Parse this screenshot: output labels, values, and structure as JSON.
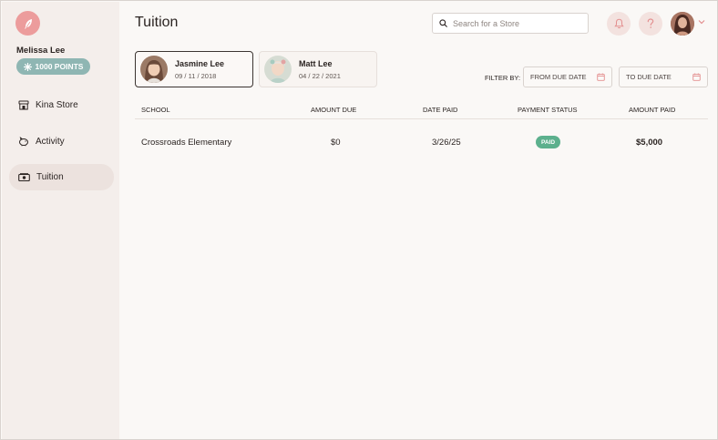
{
  "user": {
    "name": "Melissa Lee",
    "points_label": "1000 POINTS"
  },
  "sidebar": {
    "items": [
      {
        "label": "Kina Store",
        "icon": "store-icon"
      },
      {
        "label": "Activity",
        "icon": "piggy-bank-icon"
      },
      {
        "label": "Tuition",
        "icon": "money-icon",
        "active": true
      }
    ]
  },
  "header": {
    "title": "Tuition",
    "search_placeholder": "Search for a Store"
  },
  "students": [
    {
      "name": "Jasmine Lee",
      "dob": "09 / 11 / 2018",
      "selected": true
    },
    {
      "name": "Matt Lee",
      "dob": "04 / 22 / 2021",
      "selected": false
    }
  ],
  "filters": {
    "label": "FILTER BY:",
    "from_placeholder": "FROM DUE DATE",
    "to_placeholder": "TO DUE DATE"
  },
  "table": {
    "headers": [
      "SCHOOL",
      "AMOUNT DUE",
      "DATE PAID",
      "PAYMENT STATUS",
      "AMOUNT PAID"
    ],
    "rows": [
      {
        "school": "Crossroads Elementary",
        "amount_due": "$0",
        "date_paid": "3/26/25",
        "status": "PAID",
        "amount_paid": "$5,000"
      }
    ]
  },
  "colors": {
    "accent": "#ec9c9c",
    "points_badge": "#8fb6b3",
    "paid_badge": "#5cb08d",
    "sidebar_bg": "#f4eeeb"
  }
}
